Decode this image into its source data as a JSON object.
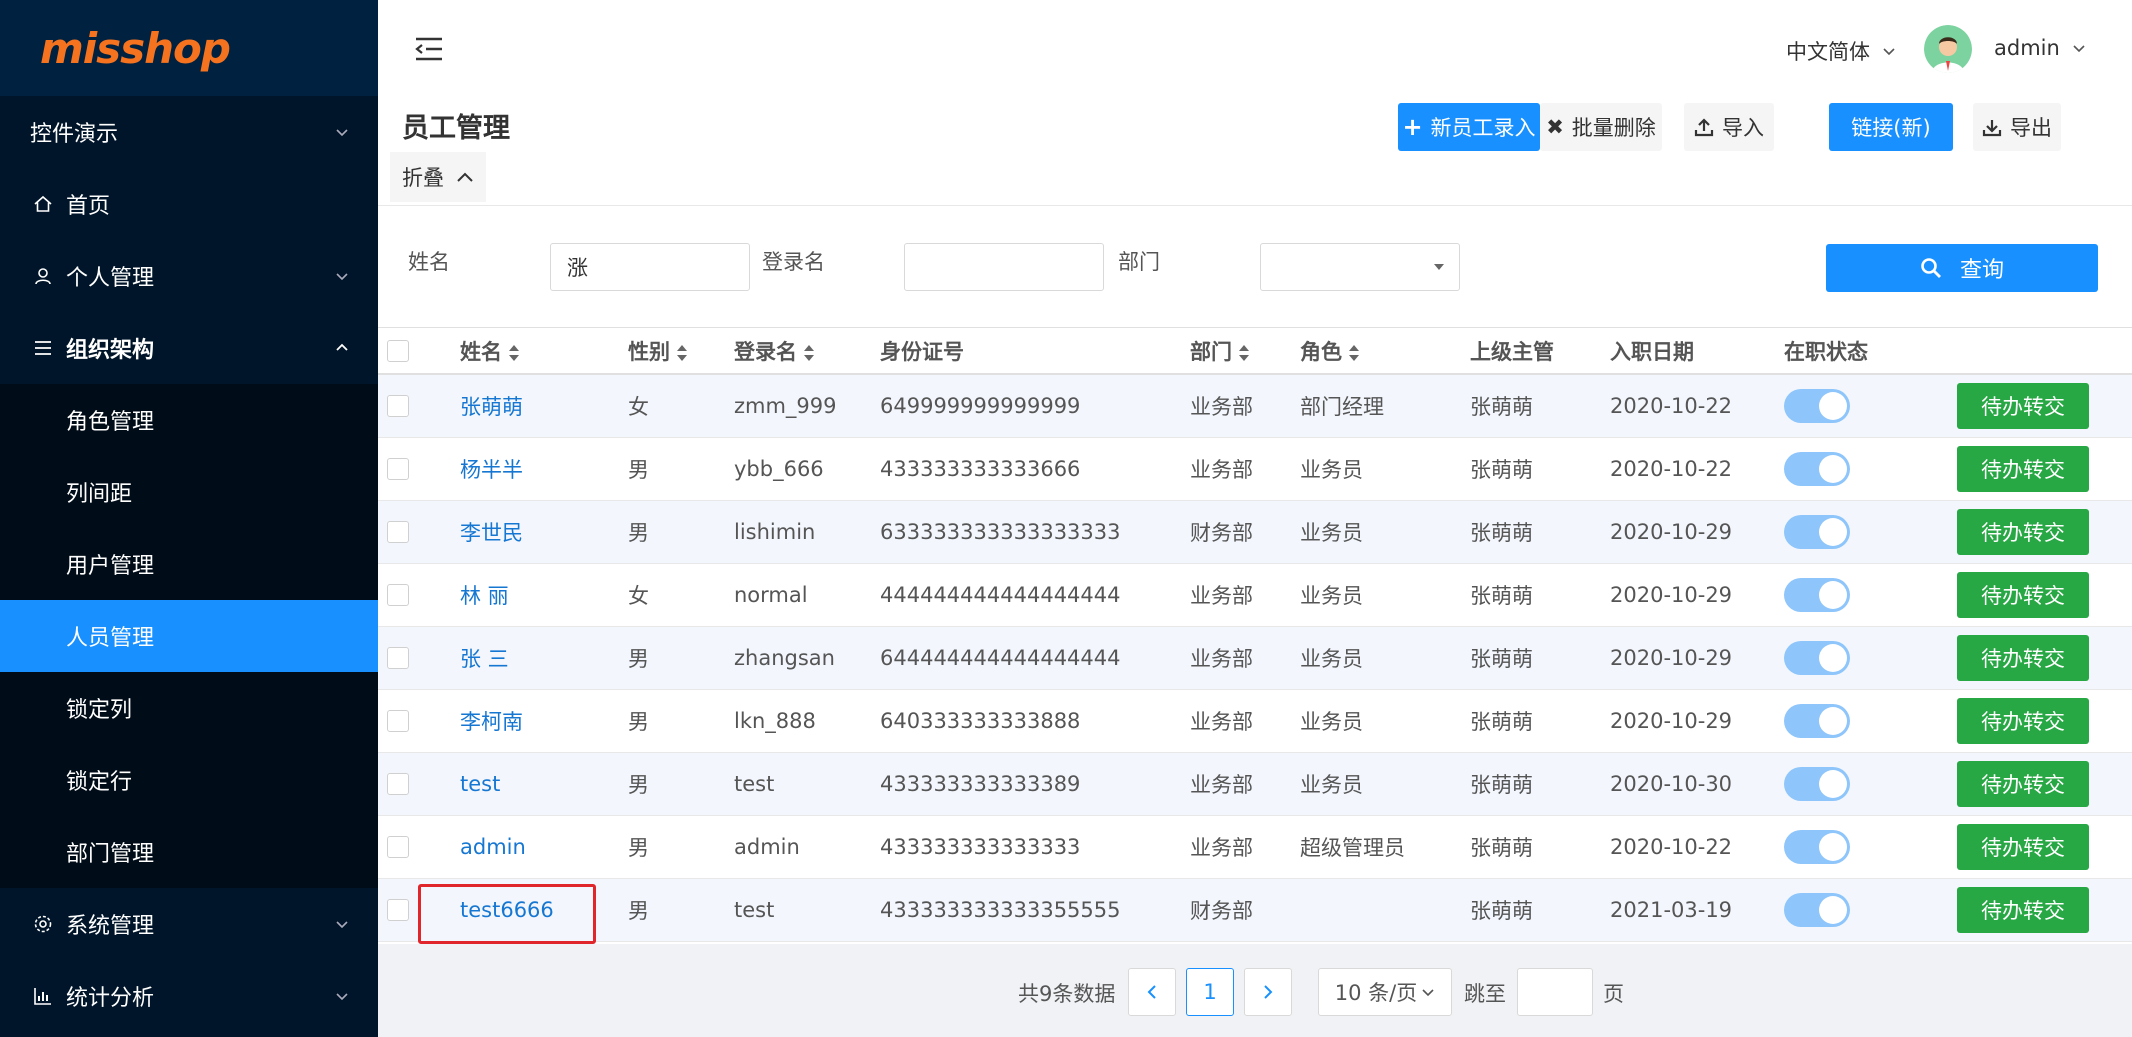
{
  "brand": {
    "logo": "misshop"
  },
  "sidebar": {
    "items": [
      {
        "label": "控件演示",
        "icon": "none",
        "has_arrow": true
      },
      {
        "label": "首页",
        "icon": "home-icon",
        "has_arrow": false
      },
      {
        "label": "个人管理",
        "icon": "user-icon",
        "has_arrow": true
      },
      {
        "label": "组织架构",
        "icon": "list-icon",
        "has_arrow": true,
        "expanded": true
      }
    ],
    "submenu": [
      {
        "label": "角色管理"
      },
      {
        "label": "列间距"
      },
      {
        "label": "用户管理"
      },
      {
        "label": "人员管理",
        "active": true
      },
      {
        "label": "锁定列"
      },
      {
        "label": "锁定行"
      },
      {
        "label": "部门管理"
      }
    ],
    "bottom_items": [
      {
        "label": "系统管理",
        "icon": "gear-icon"
      },
      {
        "label": "统计分析",
        "icon": "chart-icon"
      }
    ]
  },
  "header": {
    "language": "中文简体",
    "user": "admin"
  },
  "page": {
    "title": "员工管理",
    "collapse_label": "折叠",
    "toolbar": {
      "new_employee": "新员工录入",
      "batch_delete": "批量删除",
      "import": "导入",
      "link_new": "链接(新)",
      "export": "导出"
    }
  },
  "filters": {
    "name_label": "姓名",
    "name_value": "涨",
    "login_label": "登录名",
    "login_value": "",
    "dept_label": "部门",
    "dept_value": "",
    "query_button": "查询"
  },
  "table": {
    "headers": {
      "name": "姓名",
      "gender": "性别",
      "login": "登录名",
      "id": "身份证号",
      "dept": "部门",
      "role": "角色",
      "manager": "上级主管",
      "date": "入职日期",
      "status": "在职状态"
    },
    "action_label": "待办转交",
    "rows": [
      {
        "name": "张萌萌",
        "gender": "女",
        "login": "zmm_999",
        "id": "649999999999999",
        "dept": "业务部",
        "role": "部门经理",
        "manager": "张萌萌",
        "date": "2020-10-22",
        "active": true
      },
      {
        "name": "杨半半",
        "gender": "男",
        "login": "ybb_666",
        "id": "433333333333666",
        "dept": "业务部",
        "role": "业务员",
        "manager": "张萌萌",
        "date": "2020-10-22",
        "active": true
      },
      {
        "name": "李世民",
        "gender": "男",
        "login": "lishimin",
        "id": "633333333333333333",
        "dept": "财务部",
        "role": "业务员",
        "manager": "张萌萌",
        "date": "2020-10-29",
        "active": true
      },
      {
        "name": "林 丽",
        "gender": "女",
        "login": "normal",
        "id": "444444444444444444",
        "dept": "业务部",
        "role": "业务员",
        "manager": "张萌萌",
        "date": "2020-10-29",
        "active": true
      },
      {
        "name": "张 三",
        "gender": "男",
        "login": "zhangsan",
        "id": "644444444444444444",
        "dept": "业务部",
        "role": "业务员",
        "manager": "张萌萌",
        "date": "2020-10-29",
        "active": true
      },
      {
        "name": "李柯南",
        "gender": "男",
        "login": "lkn_888",
        "id": "640333333333888",
        "dept": "业务部",
        "role": "业务员",
        "manager": "张萌萌",
        "date": "2020-10-29",
        "active": true
      },
      {
        "name": "test",
        "gender": "男",
        "login": "test",
        "id": "433333333333389",
        "dept": "业务部",
        "role": "业务员",
        "manager": "张萌萌",
        "date": "2020-10-30",
        "active": true
      },
      {
        "name": "admin",
        "gender": "男",
        "login": "admin",
        "id": "433333333333333",
        "dept": "业务部",
        "role": "超级管理员",
        "manager": "张萌萌",
        "date": "2020-10-22",
        "active": true
      },
      {
        "name": "test6666",
        "gender": "男",
        "login": "test",
        "id": "433333333333355555",
        "dept": "财务部",
        "role": "",
        "manager": "张萌萌",
        "date": "2021-03-19",
        "active": true
      }
    ]
  },
  "pagination": {
    "total_text": "共9条数据",
    "current_page": "1",
    "page_size": "10 条/页",
    "jump_label": "跳至",
    "page_label": "页"
  },
  "colors": {
    "sidebar_bg": "#001529",
    "accent": "#1890ff",
    "action_green": "#28a745",
    "highlight_red": "#e0262b",
    "logo_orange": "#f5731f"
  }
}
